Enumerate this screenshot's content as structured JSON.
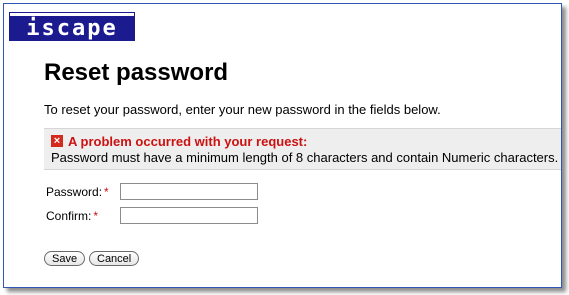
{
  "logo": {
    "text": "iscape"
  },
  "page": {
    "title": "Reset password",
    "intro": "To reset your password, enter your new password in the fields below."
  },
  "error": {
    "icon": "error-x-icon",
    "title": "A problem occurred with your request:",
    "message": "Password must have a minimum length of 8 characters and contain Numeric characters.",
    "color": "#cc1111"
  },
  "form": {
    "password_label": "Password:",
    "confirm_label": "Confirm:",
    "required_mark": "*",
    "password_value": "",
    "confirm_value": ""
  },
  "actions": {
    "save_label": "Save",
    "cancel_label": "Cancel"
  }
}
